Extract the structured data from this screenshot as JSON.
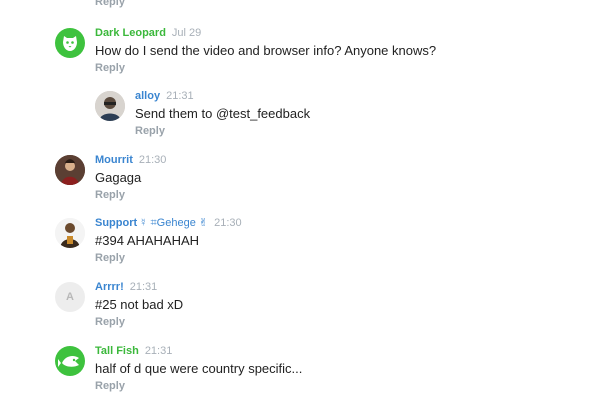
{
  "reply_label": "Reply",
  "colors": {
    "green": "#3bb83b",
    "blue": "#3a85d0",
    "muted": "#99a2aa"
  },
  "comments": [
    {
      "author": "Dark Leopard",
      "time": "Jul 29",
      "text": "How do I send the video and browser info? Anyone knows?",
      "avatar_icon": "leopard-icon"
    },
    {
      "author": "alloy",
      "time": "21:31",
      "text": "Send them to @test_feedback",
      "avatar_icon": "user-photo"
    },
    {
      "author": "Mourrit",
      "time": "21:30",
      "text": "Gagaga",
      "avatar_icon": "user-photo"
    },
    {
      "author": "Support",
      "author_suffix": "☿ ⌗Gehege ✌",
      "time": "21:30",
      "text": "#394 AHAHAHAH",
      "avatar_icon": "user-photo"
    },
    {
      "author": "Arrrr!",
      "time": "21:31",
      "text": "#25 not bad xD",
      "avatar_letter": "A"
    },
    {
      "author": "Tall Fish",
      "time": "21:31",
      "text": "half of d que were country specific...",
      "avatar_icon": "fish-icon"
    }
  ]
}
